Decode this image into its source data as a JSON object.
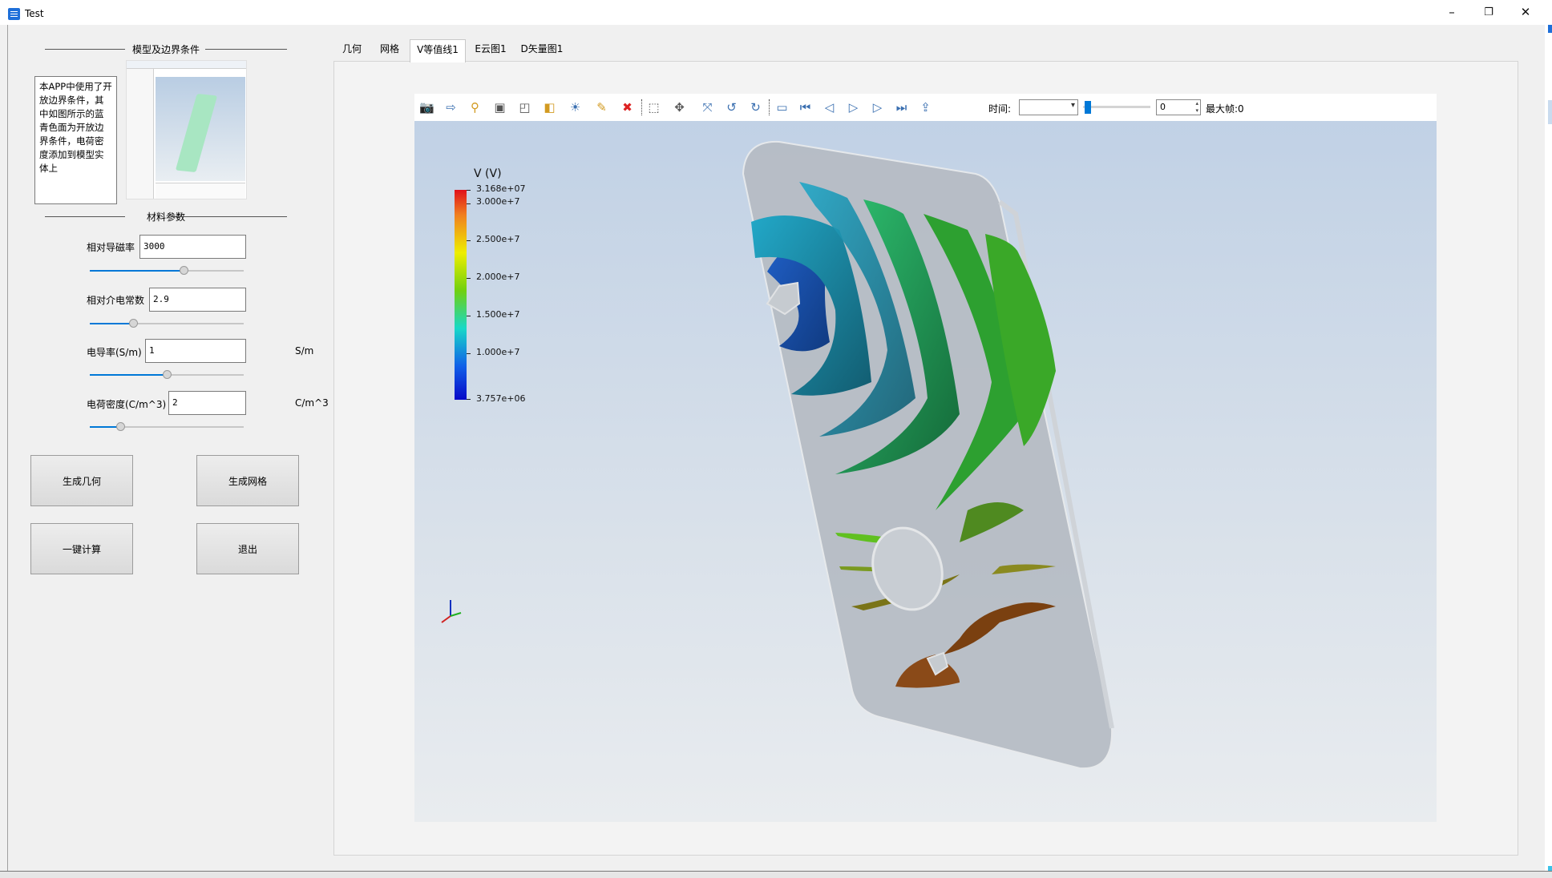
{
  "window": {
    "title": "Test",
    "controls": [
      "–",
      "❐",
      "✕"
    ]
  },
  "left_panel": {
    "model_group_title": "模型及边界条件",
    "description": "本APP中使用了开放边界条件，其中如图所示的蓝青色面为开放边界条件，电荷密度添加到模型实体上",
    "material_group_title": "材料参数",
    "params": [
      {
        "label": "相对导磁率",
        "value": "3000",
        "unit": "",
        "slider": 0.61
      },
      {
        "label": "相对介电常数",
        "value": "2.9",
        "unit": "",
        "slider": 0.28
      },
      {
        "label": "电导率(S/m)",
        "value": "1",
        "unit": "S/m",
        "slider": 0.5
      },
      {
        "label": "电荷密度(C/m^3)",
        "value": "2",
        "unit": "C/m^3",
        "slider": 0.2
      }
    ],
    "buttons": {
      "gen_geometry": "生成几何",
      "gen_mesh": "生成网格",
      "compute": "一键计算",
      "exit": "退出"
    }
  },
  "tabs": [
    "几何",
    "网格",
    "V等值线1",
    "E云图1",
    "D矢量图1"
  ],
  "active_tab": 2,
  "toolbar": {
    "time_label": "时间:",
    "time_value": "",
    "frame_value": "0",
    "max_frame_label": "最大帧:0",
    "icons": [
      "camera-icon",
      "export-icon",
      "probe-icon",
      "select-box-icon",
      "crop-icon",
      "layers-icon",
      "light-icon",
      "brush-icon",
      "clear-icon",
      "zoom-box-icon",
      "fit-icon",
      "axes-icon",
      "rotate-ccw-icon",
      "rotate-cw-icon",
      "record-icon",
      "first-frame-icon",
      "prev-frame-icon",
      "play-icon",
      "next-frame-icon",
      "last-frame-icon",
      "export-anim-icon"
    ]
  },
  "legend": {
    "title": "V (V)",
    "max": "3.168e+07",
    "min": "3.757e+06",
    "ticks": [
      "3.000e+7",
      "2.500e+7",
      "2.000e+7",
      "1.500e+7",
      "1.000e+7"
    ]
  },
  "colors": {
    "accent": "#0078d7",
    "viewport_top": "#bfd0e5",
    "viewport_bottom": "#e9ecef"
  }
}
